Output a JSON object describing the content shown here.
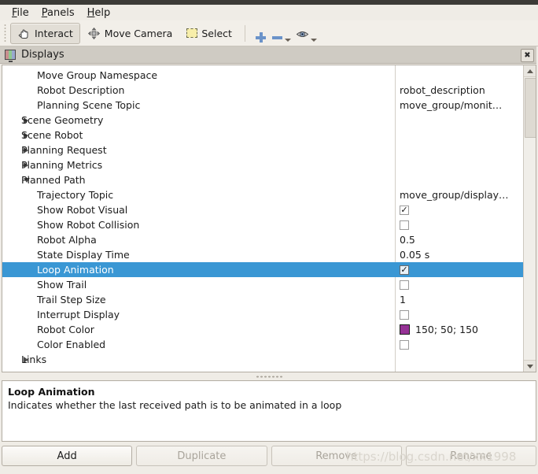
{
  "window": {
    "title": "Displays",
    "close_label": "✖",
    "panel_icon": "monitor-icon"
  },
  "menubar": {
    "items": [
      {
        "name": "file",
        "label": "File",
        "mnemonic": "F"
      },
      {
        "name": "panels",
        "label": "Panels",
        "mnemonic": "P"
      },
      {
        "name": "help",
        "label": "Help",
        "mnemonic": "H"
      }
    ]
  },
  "toolbar": {
    "interact_label": "Interact",
    "move_camera_label": "Move Camera",
    "select_label": "Select",
    "icons": [
      "hand-cursor-icon",
      "move-camera-icon",
      "select-rect-icon",
      "plus-icon",
      "minus-icon",
      "eye-icon"
    ]
  },
  "tree": {
    "rows": [
      {
        "label": "Move Group Namespace",
        "indent": 2,
        "arrow": "none",
        "value_type": "text",
        "value": ""
      },
      {
        "label": "Robot Description",
        "indent": 2,
        "arrow": "none",
        "value_type": "text",
        "value": "robot_description"
      },
      {
        "label": "Planning Scene Topic",
        "indent": 2,
        "arrow": "none",
        "value_type": "text",
        "value": "move_group/monit…"
      },
      {
        "label": "Scene Geometry",
        "indent": 1,
        "arrow": "collapsed",
        "value_type": "text",
        "value": ""
      },
      {
        "label": "Scene Robot",
        "indent": 1,
        "arrow": "collapsed",
        "value_type": "text",
        "value": ""
      },
      {
        "label": "Planning Request",
        "indent": 1,
        "arrow": "collapsed",
        "value_type": "text",
        "value": ""
      },
      {
        "label": "Planning Metrics",
        "indent": 1,
        "arrow": "collapsed",
        "value_type": "text",
        "value": ""
      },
      {
        "label": "Planned Path",
        "indent": 1,
        "arrow": "expanded",
        "value_type": "text",
        "value": ""
      },
      {
        "label": "Trajectory Topic",
        "indent": 2,
        "arrow": "none",
        "value_type": "text",
        "value": "move_group/display…"
      },
      {
        "label": "Show Robot Visual",
        "indent": 2,
        "arrow": "none",
        "value_type": "checkbox",
        "value": "✓"
      },
      {
        "label": "Show Robot Collision",
        "indent": 2,
        "arrow": "none",
        "value_type": "checkbox",
        "value": ""
      },
      {
        "label": "Robot Alpha",
        "indent": 2,
        "arrow": "none",
        "value_type": "text",
        "value": "0.5"
      },
      {
        "label": "State Display Time",
        "indent": 2,
        "arrow": "none",
        "value_type": "text",
        "value": "0.05 s"
      },
      {
        "label": "Loop Animation",
        "indent": 2,
        "arrow": "none",
        "value_type": "checkbox",
        "value": "✓",
        "selected": true
      },
      {
        "label": "Show Trail",
        "indent": 2,
        "arrow": "none",
        "value_type": "checkbox",
        "value": ""
      },
      {
        "label": "Trail Step Size",
        "indent": 2,
        "arrow": "none",
        "value_type": "text",
        "value": "1"
      },
      {
        "label": "Interrupt Display",
        "indent": 2,
        "arrow": "none",
        "value_type": "checkbox",
        "value": ""
      },
      {
        "label": "Robot Color",
        "indent": 2,
        "arrow": "none",
        "value_type": "color",
        "value": "150; 50; 150",
        "color": "#963296"
      },
      {
        "label": "Color Enabled",
        "indent": 2,
        "arrow": "none",
        "value_type": "checkbox",
        "value": ""
      },
      {
        "label": "Links",
        "indent": 1,
        "arrow": "collapsed",
        "value_type": "text",
        "value": ""
      }
    ],
    "selection_color": "#3a97d4"
  },
  "description": {
    "title": "Loop Animation",
    "text": "Indicates whether the last received path is to be animated in a loop"
  },
  "buttons": [
    {
      "name": "add",
      "label": "Add",
      "enabled": true
    },
    {
      "name": "duplicate",
      "label": "Duplicate",
      "enabled": false
    },
    {
      "name": "remove",
      "label": "Remove",
      "enabled": false
    },
    {
      "name": "rename",
      "label": "Rename",
      "enabled": false
    }
  ],
  "watermark": {
    "text": "https://blog.csdn.net/xx1998"
  }
}
